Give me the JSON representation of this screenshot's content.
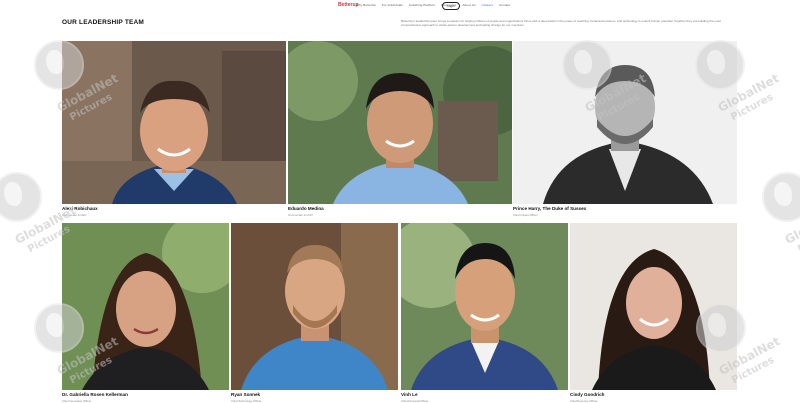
{
  "header": {
    "brand": "Betterup",
    "nav": [
      "Why BetterUp",
      "For Individuals",
      "Coaching Platform",
      "Resources",
      "About Us",
      "Careers",
      "Contact"
    ],
    "active_index": 5,
    "cta": "Login"
  },
  "section": {
    "title": "OUR LEADERSHIP TEAM",
    "intro": "BetterUp's leadership team brings a passion for helping millions of people and organizations thrive with a deep belief in the power of coaching, behavioral science, and technology to unlock human potential. Together they are building the most comprehensive approach to whole-person development and lasting change for our members."
  },
  "team": [
    {
      "name": "Alexi Robichaux",
      "role": "Co-Founder & CEO"
    },
    {
      "name": "Eduardo Medina",
      "role": "Co-Founder & COO"
    },
    {
      "name": "Prince Harry, The Duke of Sussex",
      "role": "Chief Impact Officer"
    },
    {
      "name": "Dr. Gabriella Rosen Kellerman",
      "role": "Chief Innovation Officer"
    },
    {
      "name": "Ryan Sonnek",
      "role": "Chief Technology Officer"
    },
    {
      "name": "Vinh Le",
      "role": "Chief Financial Officer"
    },
    {
      "name": "Cindy Goodrich",
      "role": "Chief Revenue Officer"
    }
  ],
  "watermark": {
    "line1": "GlobalNet",
    "line2": "Pictures"
  },
  "colors": {
    "brand": "#d8334a",
    "active_nav": "#2a6fd6"
  }
}
